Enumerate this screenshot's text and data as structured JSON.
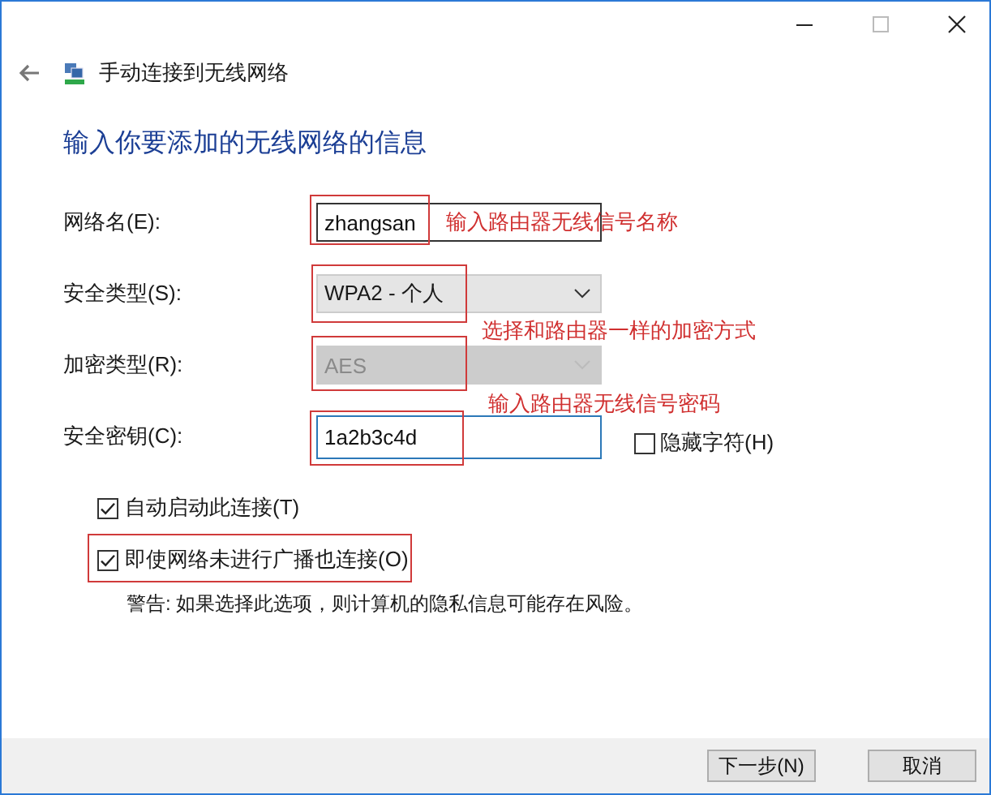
{
  "header": {
    "title": "手动连接到无线网络"
  },
  "heading": "输入你要添加的无线网络的信息",
  "fields": [
    {
      "kind": "text",
      "label": "网络名(E):",
      "value": "zhangsan",
      "focused": false,
      "highlighted": true,
      "note": {
        "text": "输入路由器无线信号名称",
        "kind": "inside"
      }
    },
    {
      "kind": "select",
      "label": "安全类型(S):",
      "value": "WPA2 - 个人",
      "disabled": false,
      "highlighted": true,
      "note": {
        "text": "选择和路由器一样的加密方式",
        "kind": "below"
      }
    },
    {
      "kind": "select",
      "label": "加密类型(R):",
      "value": "AES",
      "disabled": true,
      "highlighted": true
    },
    {
      "kind": "text",
      "label": "安全密钥(C):",
      "value": "1a2b3c4d",
      "focused": true,
      "highlighted": true,
      "note": {
        "text": "输入路由器无线信号密码",
        "kind": "above"
      },
      "option": {
        "label": "隐藏字符(H)",
        "checked": false
      }
    }
  ],
  "options": [
    {
      "label": "自动启动此连接(T)",
      "checked": true,
      "highlighted": false
    },
    {
      "label": "即使网络未进行广播也连接(O)",
      "checked": true,
      "highlighted": true
    }
  ],
  "warning": "警告: 如果选择此选项，则计算机的隐私信息可能存在风险。",
  "buttons": [
    {
      "label": "下一步(N)"
    },
    {
      "label": "取消"
    }
  ]
}
